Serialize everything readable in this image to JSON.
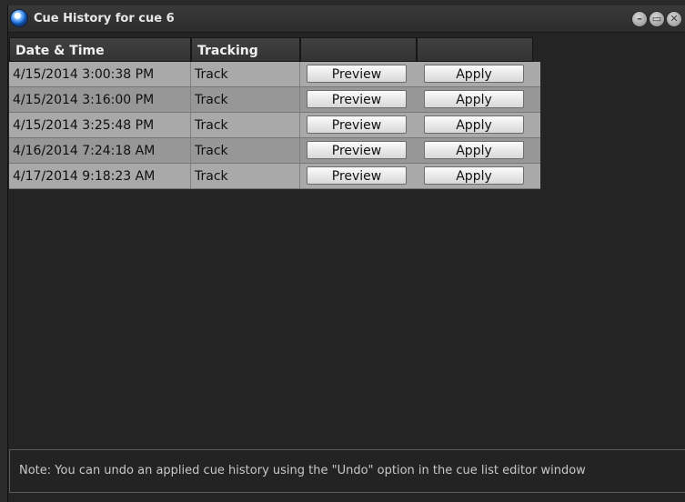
{
  "window": {
    "title": "Cue History for cue 6"
  },
  "columns": {
    "date": "Date & Time",
    "tracking": "Tracking",
    "col3": "",
    "col4": ""
  },
  "rows": [
    {
      "date": "4/15/2014 3:00:38 PM",
      "tracking": "Track",
      "preview": "Preview",
      "apply": "Apply"
    },
    {
      "date": "4/15/2014 3:16:00 PM",
      "tracking": "Track",
      "preview": "Preview",
      "apply": "Apply"
    },
    {
      "date": "4/15/2014 3:25:48 PM",
      "tracking": "Track",
      "preview": "Preview",
      "apply": "Apply"
    },
    {
      "date": "4/16/2014 7:24:18 AM",
      "tracking": "Track",
      "preview": "Preview",
      "apply": "Apply"
    },
    {
      "date": "4/17/2014 9:18:23 AM",
      "tracking": "Track",
      "preview": "Preview",
      "apply": "Apply"
    }
  ],
  "note": "Note: You can undo an applied cue history using the \"Undo\" option in the cue list editor window",
  "icons": {
    "app": "app-globe-icon",
    "minimize": "minimize-icon",
    "maximize": "maximize-icon",
    "close": "close-icon"
  }
}
